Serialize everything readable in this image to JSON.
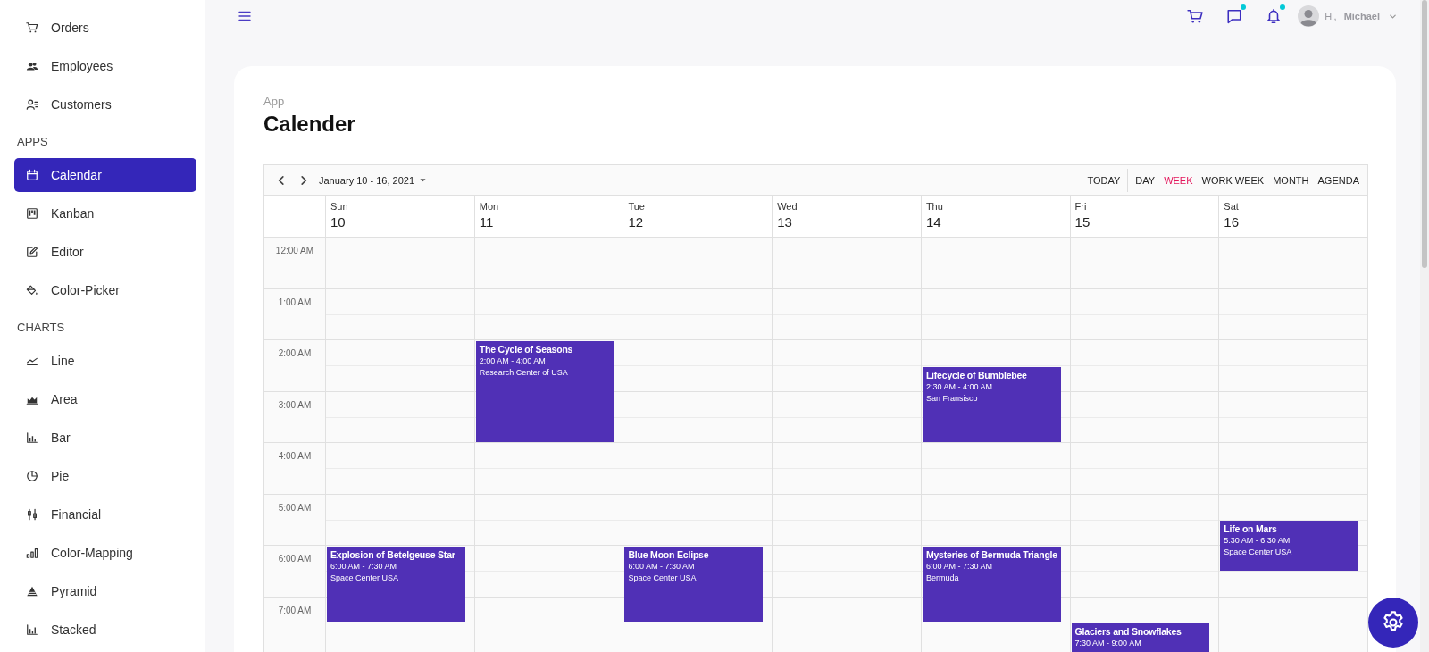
{
  "sidebar": {
    "groups": [
      {
        "items": [
          {
            "label": "Orders",
            "selected": false
          },
          {
            "label": "Employees",
            "selected": false
          },
          {
            "label": "Customers",
            "selected": false
          }
        ]
      },
      {
        "title": "APPS",
        "items": [
          {
            "label": "Calendar",
            "selected": true
          },
          {
            "label": "Kanban",
            "selected": false
          },
          {
            "label": "Editor",
            "selected": false
          },
          {
            "label": "Color-Picker",
            "selected": false
          }
        ]
      },
      {
        "title": "CHARTS",
        "items": [
          {
            "label": "Line",
            "selected": false
          },
          {
            "label": "Area",
            "selected": false
          },
          {
            "label": "Bar",
            "selected": false
          },
          {
            "label": "Pie",
            "selected": false
          },
          {
            "label": "Financial",
            "selected": false
          },
          {
            "label": "Color-Mapping",
            "selected": false
          },
          {
            "label": "Pyramid",
            "selected": false
          },
          {
            "label": "Stacked",
            "selected": false
          }
        ]
      }
    ]
  },
  "header": {
    "buttons": [
      {
        "notification": false
      },
      {
        "notification": true
      },
      {
        "notification": true
      }
    ],
    "greeting": "Hi,",
    "user_name": "Michael"
  },
  "page": {
    "breadcrumb": "App",
    "title": "Calender"
  },
  "calendar": {
    "date_range": "January 10 - 16, 2021",
    "today": "TODAY",
    "views": [
      {
        "label": "DAY",
        "selected": false
      },
      {
        "label": "WEEK",
        "selected": true
      },
      {
        "label": "WORK WEEK",
        "selected": false
      },
      {
        "label": "MONTH",
        "selected": false
      },
      {
        "label": "AGENDA",
        "selected": false
      }
    ],
    "time_slots": [
      "12:00 AM",
      "1:00 AM",
      "2:00 AM",
      "3:00 AM",
      "4:00 AM",
      "5:00 AM",
      "6:00 AM",
      "7:00 AM"
    ],
    "days": [
      {
        "name": "Sun",
        "date": "10",
        "events": [
          {
            "title": "Explosion of Betelgeuse Star",
            "time": "6:00 AM - 7:30 AM",
            "location": "Space Center USA"
          }
        ]
      },
      {
        "name": "Mon",
        "date": "11",
        "events": [
          {
            "title": "The Cycle of Seasons",
            "time": "2:00 AM - 4:00 AM",
            "location": "Research Center of USA"
          }
        ]
      },
      {
        "name": "Tue",
        "date": "12",
        "events": [
          {
            "title": "Blue Moon Eclipse",
            "time": "6:00 AM - 7:30 AM",
            "location": "Space Center USA"
          }
        ]
      },
      {
        "name": "Wed",
        "date": "13"
      },
      {
        "name": "Thu",
        "date": "14",
        "events": [
          {
            "title": "Lifecycle of Bumblebee",
            "time": "2:30 AM - 4:00 AM",
            "location": "San Fransisco"
          },
          {
            "title": "Mysteries of Bermuda Triangle",
            "time": "6:00 AM - 7:30 AM",
            "location": "Bermuda"
          }
        ]
      },
      {
        "name": "Fri",
        "date": "15",
        "events": [
          {
            "title": "Glaciers and Snowflakes",
            "time": "7:30 AM - 9:00 AM"
          }
        ]
      },
      {
        "name": "Sat",
        "date": "16",
        "events": [
          {
            "title": "Life on Mars",
            "time": "5:30 AM - 6:30 AM",
            "location": "Space Center USA"
          }
        ]
      }
    ]
  }
}
